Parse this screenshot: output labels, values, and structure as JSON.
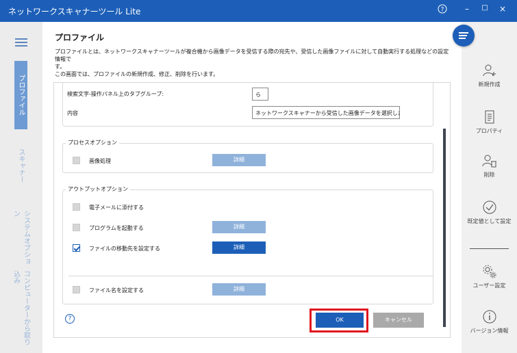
{
  "window": {
    "title": "ネットワークスキャナーツール Lite",
    "help_glyph": "?",
    "minimize_glyph": "–",
    "maximize_glyph": "□",
    "close_glyph": "×"
  },
  "left_nav": {
    "items": [
      {
        "label": "プロファイル",
        "active": true
      },
      {
        "label": "スキャナー",
        "active": false
      },
      {
        "label": "システムオプション",
        "active": false
      },
      {
        "label": "コンピューターから取り込み",
        "active": false
      }
    ]
  },
  "page": {
    "title": "プロファイル",
    "description_line1": "プロファイルとは、ネットワークスキャナーツールが複合機から画像データを受信する際の宛先や、受信した画像ファイルに対して自動実行する処理などの設定情報で",
    "description_line2": "す。",
    "description_line3": "この画面では、プロファイルの新規作成、修正、削除を行います。"
  },
  "form": {
    "search_label": "検索文字-操作パネル上のタブグループ:",
    "search_value": "ら",
    "content_label": "内容",
    "content_value": "ネットワークスキャナーから受信した画像データを選択したフォル",
    "process_options": {
      "legend": "プロセスオプション",
      "image_processing_label": "画像処理",
      "detail_label": "詳細"
    },
    "output_options": {
      "legend": "アウトプットオプション",
      "email_label": "電子メールに添付する",
      "program_label": "プログラムを起動する",
      "program_detail_label": "詳細",
      "move_label": "ファイルの移動先を設定する",
      "move_detail_label": "詳細",
      "filename_label": "ファイル名を設定する",
      "filename_detail_label": "詳細"
    },
    "help_glyph": "?",
    "ok_label": "OK",
    "cancel_label": "キャンセル"
  },
  "right_nav": {
    "items": [
      {
        "label": "新規作成",
        "icon": "add-user-icon"
      },
      {
        "label": "プロパティ",
        "icon": "properties-icon"
      },
      {
        "label": "削除",
        "icon": "delete-user-icon"
      },
      {
        "label": "既定値として設定",
        "icon": "check-circle-icon"
      },
      {
        "label": "ユーザー設定",
        "icon": "gear-icon"
      },
      {
        "label": "バージョン情報",
        "icon": "info-icon"
      }
    ]
  },
  "colors": {
    "brand": "#1d5fb8",
    "highlight": "#e0141e",
    "detail_button": "#8fb2db",
    "cancel_button": "#a9a9a9"
  }
}
